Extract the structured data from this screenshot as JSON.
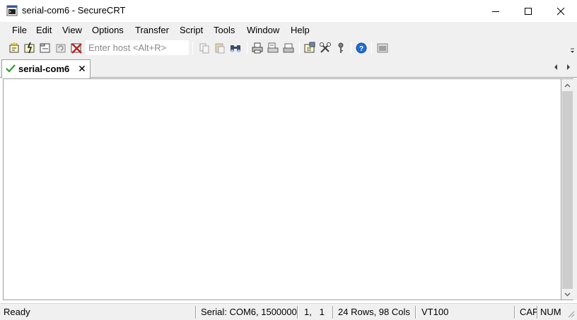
{
  "window": {
    "title": "serial-com6 - SecureCRT",
    "controls": [
      "minimize",
      "maximize",
      "close"
    ]
  },
  "menu": [
    {
      "label": "File"
    },
    {
      "label": "Edit"
    },
    {
      "label": "View"
    },
    {
      "label": "Options"
    },
    {
      "label": "Transfer"
    },
    {
      "label": "Script"
    },
    {
      "label": "Tools"
    },
    {
      "label": "Window"
    },
    {
      "label": "Help"
    }
  ],
  "toolbar": {
    "host_placeholder": "Enter host <Alt+R>",
    "icons": [
      "connect-icon",
      "quick-connect-icon",
      "connect-in-tab-icon",
      "reconnect-icon",
      "disconnect-icon",
      "copy-icon",
      "paste-icon",
      "find-icon",
      "print-icon",
      "print-selection-icon",
      "print-screen-icon",
      "session-options-icon",
      "global-options-icon",
      "keymap-icon",
      "help-icon",
      "sftp-icon"
    ]
  },
  "tabs": [
    {
      "label": "serial-com6",
      "status": "connected"
    }
  ],
  "status": {
    "ready": "Ready",
    "connection": "Serial: COM6, 1500000",
    "cursor": "1,   1",
    "size": "24 Rows, 98 Cols",
    "emulation": "VT100",
    "caps": "CAP",
    "num": "NUM"
  },
  "colors": {
    "chrome": "#f0f0f0",
    "terminal_bg": "#ffffff",
    "check_green": "#2f9a2f",
    "disconnect_red": "#c0201c",
    "help_blue": "#1f6fd1"
  }
}
